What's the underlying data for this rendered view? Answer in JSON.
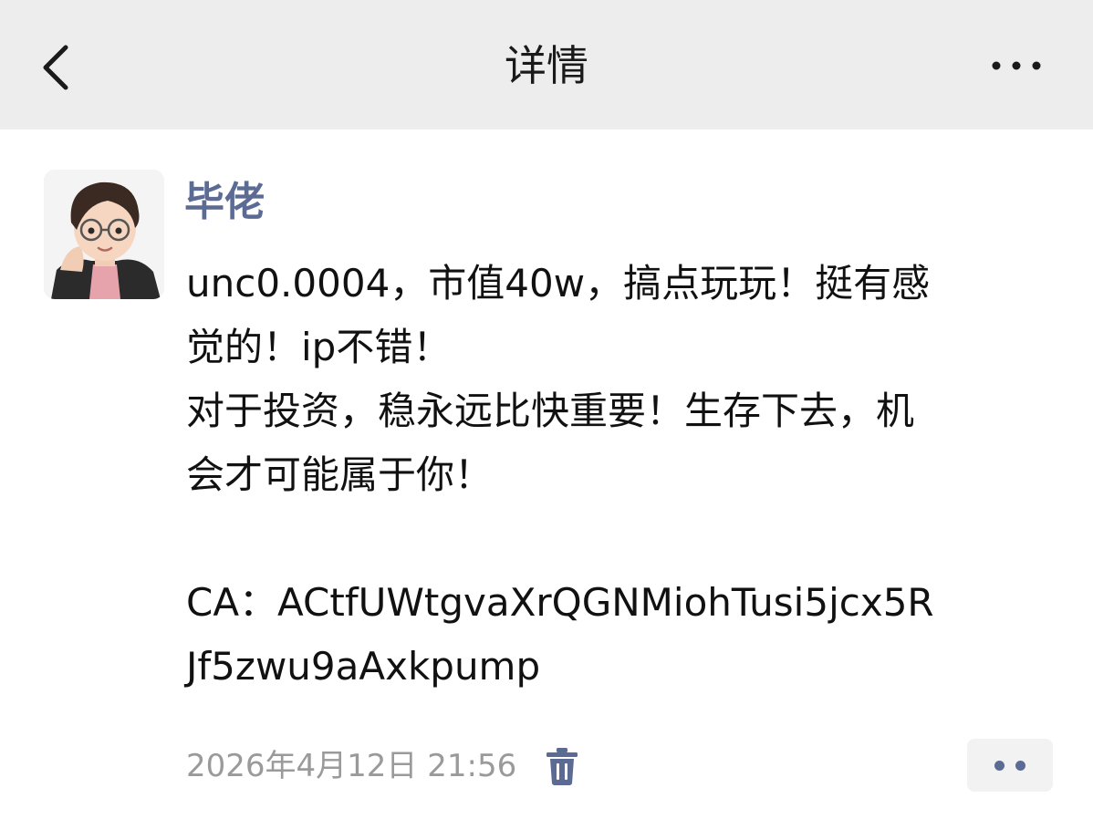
{
  "header": {
    "title": "详情",
    "back_icon": "chevron-left-icon",
    "more_icon": "ellipsis-icon"
  },
  "post": {
    "author": "毕佬",
    "avatar_icon": "cartoon-avatar",
    "lines": [
      "unc0.0004，市值40w，搞点玩玩！挺有感",
      "觉的！ip不错！",
      "对于投资，稳永远比快重要！生存下去，机",
      "会才可能属于你！",
      "",
      "CA：ACtfUWtgvaXrQGNMiohTusi5jcx5R",
      "Jf5zwu9aAxkpump"
    ],
    "timestamp": "2026年4月12日 21:56",
    "delete_icon": "trash-icon",
    "action_icon": "two-dots-icon"
  },
  "colors": {
    "header_bg": "#ededed",
    "author_name": "#5b6b93",
    "timestamp": "#9a9a9a",
    "body_text": "#111111"
  }
}
